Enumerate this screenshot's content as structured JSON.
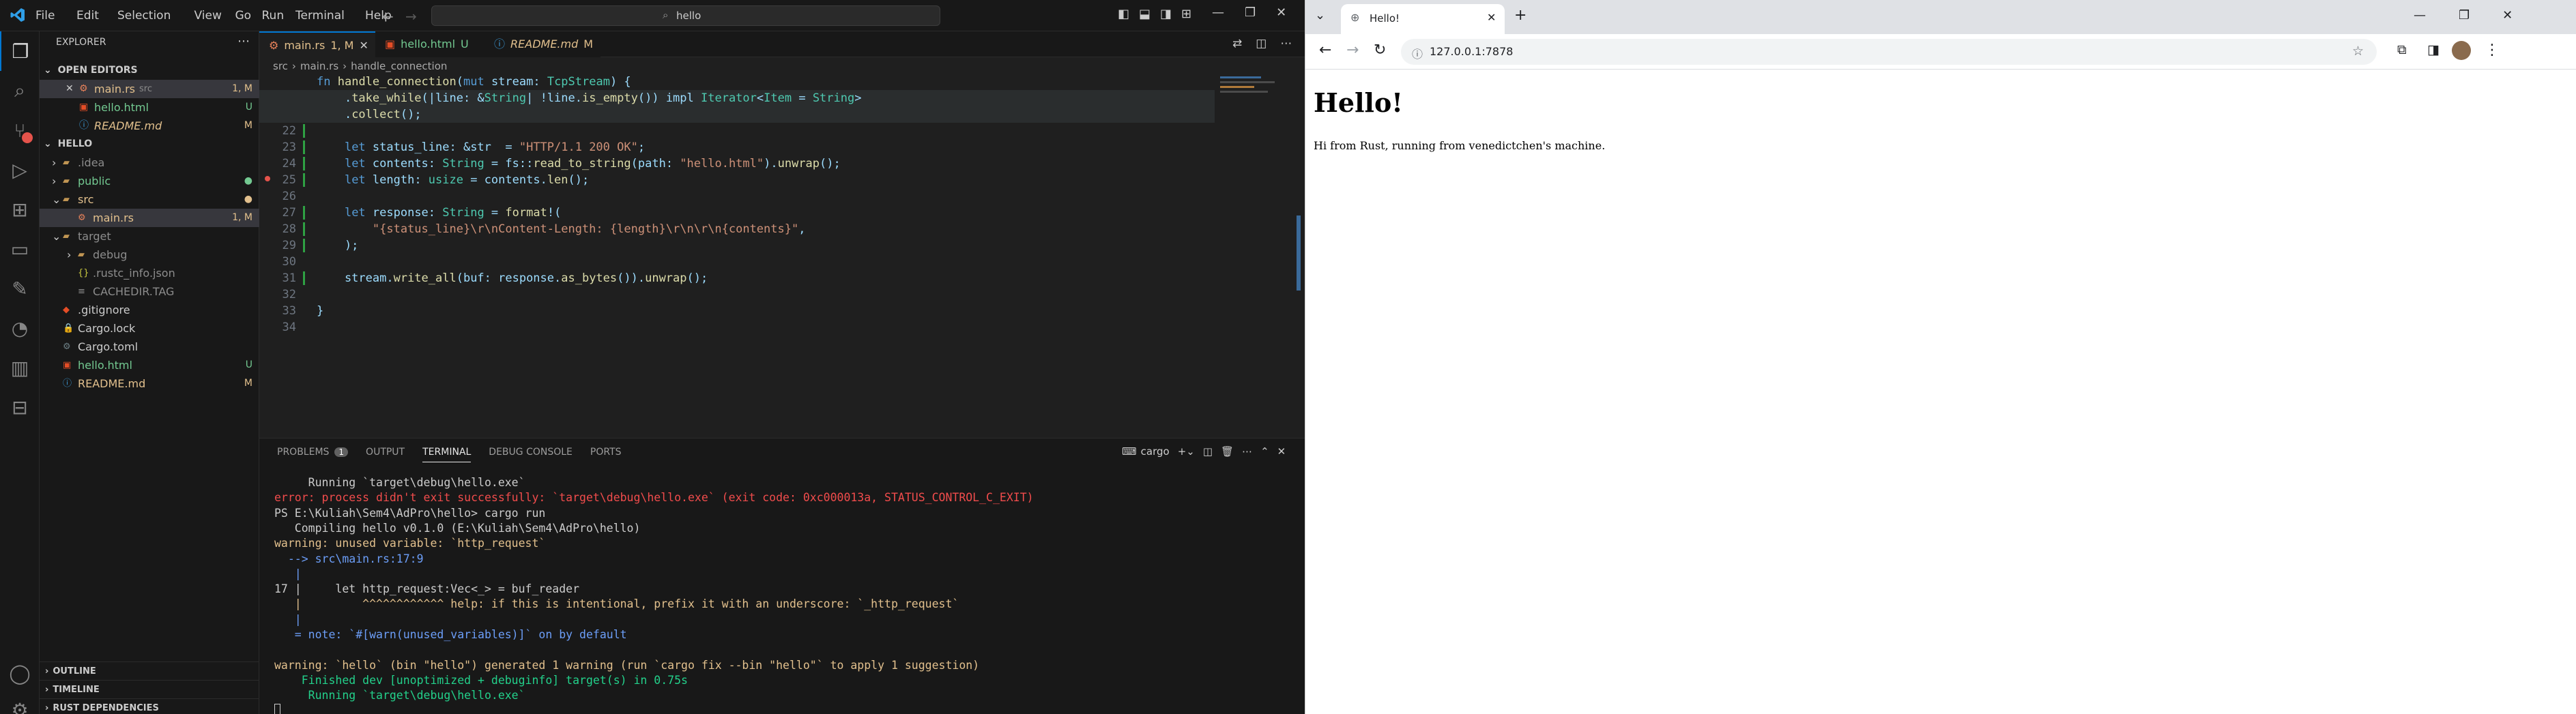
{
  "vscode": {
    "menu": [
      "File",
      "Edit",
      "Selection",
      "View",
      "Go",
      "Run",
      "Terminal",
      "Help"
    ],
    "search_text": "hello",
    "explorer": {
      "title": "EXPLORER",
      "open_editors_title": "OPEN EDITORS",
      "open_editors": [
        {
          "name": "main.rs",
          "extra": "src",
          "badge": "1, M",
          "color": "#e2c08d",
          "close": true
        },
        {
          "name": "hello.html",
          "badge": "U",
          "color": "#73c991"
        },
        {
          "name": "README.md",
          "badge": "M",
          "color": "#e2c08d"
        }
      ],
      "project_title": "HELLO",
      "tree": [
        {
          "name": ".idea",
          "indent": 1,
          "type": "folder",
          "color": "#8c8c8c"
        },
        {
          "name": "public",
          "indent": 1,
          "type": "folder",
          "color": "#73c991",
          "badge": "●"
        },
        {
          "name": "src",
          "indent": 1,
          "type": "folder-open",
          "color": "#e2c08d",
          "badge": "●"
        },
        {
          "name": "main.rs",
          "indent": 2,
          "type": "rust",
          "color": "#e2c08d",
          "badge": "1, M"
        },
        {
          "name": "target",
          "indent": 1,
          "type": "folder-open",
          "color": "#8c8c8c"
        },
        {
          "name": "debug",
          "indent": 2,
          "type": "folder",
          "color": "#8c8c8c"
        },
        {
          "name": ".rustc_info.json",
          "indent": 2,
          "type": "json",
          "color": "#8c8c8c"
        },
        {
          "name": "CACHEDIR.TAG",
          "indent": 2,
          "type": "file",
          "color": "#8c8c8c"
        },
        {
          "name": ".gitignore",
          "indent": 1,
          "type": "git",
          "color": "#cccccc"
        },
        {
          "name": "Cargo.lock",
          "indent": 1,
          "type": "lock",
          "color": "#cccccc"
        },
        {
          "name": "Cargo.toml",
          "indent": 1,
          "type": "gear",
          "color": "#cccccc"
        },
        {
          "name": "hello.html",
          "indent": 1,
          "type": "html",
          "color": "#73c991",
          "badge": "U"
        },
        {
          "name": "README.md",
          "indent": 1,
          "type": "info",
          "color": "#e2c08d",
          "badge": "M"
        }
      ],
      "footer": [
        "OUTLINE",
        "TIMELINE",
        "RUST DEPENDENCIES"
      ]
    },
    "tabs": [
      {
        "label": "main.rs",
        "badge": "1, M",
        "active": true,
        "color": "#e2c08d"
      },
      {
        "label": "hello.html",
        "badge": "U",
        "active": false,
        "color": "#73c991"
      },
      {
        "label": "README.md",
        "badge": "M",
        "active": false,
        "color": "#e2c08d"
      }
    ],
    "breadcrumb": [
      "src",
      "main.rs",
      "handle_connection"
    ],
    "code": [
      {
        "ln": "",
        "html": "fn handle_connection(mut stream: TcpStream) {"
      },
      {
        "ln": "",
        "html": "    .take_while(|line: &String| !line.is_empty()) impl Iterator<Item = String>"
      },
      {
        "ln": "",
        "html": "    .collect();"
      },
      {
        "ln": "22",
        "html": ""
      },
      {
        "ln": "23",
        "html": "    let status_line: &str  = \"HTTP/1.1 200 OK\";"
      },
      {
        "ln": "24",
        "html": "    let contents: String = fs::read_to_string(path: \"hello.html\").unwrap();"
      },
      {
        "ln": "25",
        "html": "    let length: usize = contents.len();"
      },
      {
        "ln": "26",
        "html": ""
      },
      {
        "ln": "27",
        "html": "    let response: String = format!("
      },
      {
        "ln": "28",
        "html": "        \"{status_line}\\r\\nContent-Length: {length}\\r\\n\\r\\n{contents}\","
      },
      {
        "ln": "29",
        "html": "    );"
      },
      {
        "ln": "30",
        "html": ""
      },
      {
        "ln": "31",
        "html": "    stream.write_all(buf: response.as_bytes()).unwrap();"
      },
      {
        "ln": "32",
        "html": ""
      },
      {
        "ln": "33",
        "html": "}"
      },
      {
        "ln": "34",
        "html": ""
      }
    ],
    "panel_tabs": [
      "PROBLEMS",
      "OUTPUT",
      "TERMINAL",
      "DEBUG CONSOLE",
      "PORTS"
    ],
    "problems_count": "1",
    "terminal_name": "cargo",
    "terminal": [
      "     Running `target\\debug\\hello.exe`",
      "error: process didn't exit successfully: `target\\debug\\hello.exe` (exit code: 0xc000013a, STATUS_CONTROL_C_EXIT)",
      "PS E:\\Kuliah\\Sem4\\AdPro\\hello> cargo run",
      "   Compiling hello v0.1.0 (E:\\Kuliah\\Sem4\\AdPro\\hello)",
      "warning: unused variable: `http_request`",
      "  --> src\\main.rs:17:9",
      "   |",
      "17 |     let http_request:Vec<_> = buf_reader",
      "   |         ^^^^^^^^^^^^ help: if this is intentional, prefix it with an underscore: `_http_request`",
      "   |",
      "   = note: `#[warn(unused_variables)]` on by default",
      "",
      "warning: `hello` (bin \"hello\") generated 1 warning (run `cargo fix --bin \"hello\"` to apply 1 suggestion)",
      "    Finished dev [unoptimized + debuginfo] target(s) in 0.75s",
      "     Running `target\\debug\\hello.exe`"
    ]
  },
  "browser": {
    "tab_title": "Hello!",
    "url": "127.0.0.1:7878",
    "heading": "Hello!",
    "paragraph": "Hi from Rust, running from venedictchen's machine."
  }
}
